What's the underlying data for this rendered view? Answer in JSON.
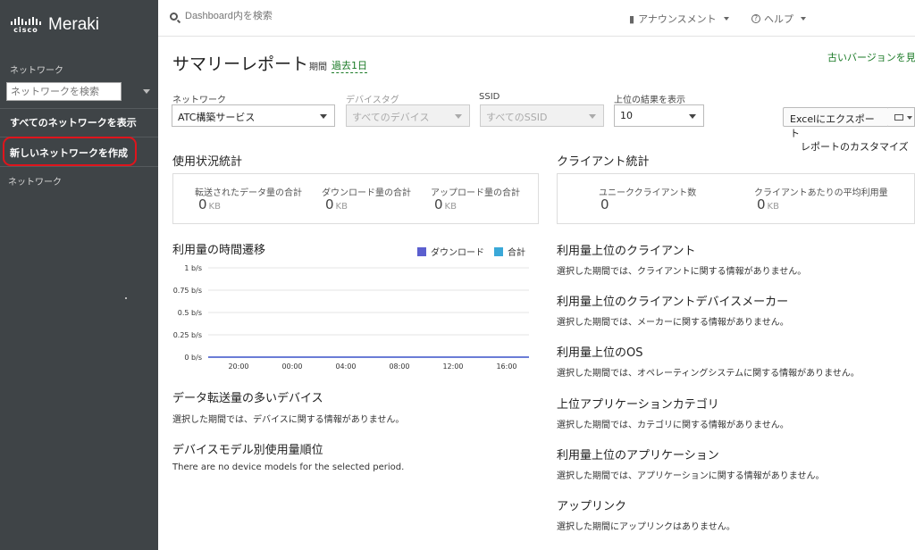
{
  "sidebar": {
    "brand_cisco": "cisco",
    "brand_name": "Meraki",
    "network_label": "ネットワーク",
    "search_placeholder": "ネットワークを検索",
    "show_all": "すべてのネットワークを表示",
    "create_new": "新しいネットワークを作成",
    "network_label_2": "ネットワーク"
  },
  "topbar": {
    "search_placeholder": "Dashboard内を検索",
    "announcements": "アナウンスメント",
    "help": "ヘルプ"
  },
  "header": {
    "title": "サマリーレポート",
    "period_label": "期間",
    "period_value": "過去1日",
    "old_version": "古いバージョンを見る"
  },
  "filters": {
    "network": {
      "label": "ネットワーク",
      "value": "ATC構築サービス"
    },
    "device_tag": {
      "label": "デバイスタグ",
      "value": "すべてのデバイス"
    },
    "ssid": {
      "label": "SSID",
      "value": "すべてのSSID"
    },
    "top_results": {
      "label": "上位の結果を表示",
      "value": "10"
    }
  },
  "toolbar": {
    "export_excel": "Excelにエクスポート",
    "customize": "レポートのカスタマイズ"
  },
  "usage_stats": {
    "title": "使用状況統計",
    "items": [
      {
        "label": "転送されたデータ量の合計",
        "value": "0",
        "unit": "KB"
      },
      {
        "label": "ダウンロード量の合計",
        "value": "0",
        "unit": "KB"
      },
      {
        "label": "アップロード量の合計",
        "value": "0",
        "unit": "KB"
      }
    ]
  },
  "client_stats": {
    "title": "クライアント統計",
    "items": [
      {
        "label": "ユニーククライアント数",
        "value": "0",
        "unit": ""
      },
      {
        "label": "クライアントあたりの平均利用量",
        "value": "0",
        "unit": "KB"
      }
    ]
  },
  "chart_data": {
    "type": "line",
    "title": "利用量の時間遷移",
    "x": [
      "20:00",
      "00:00",
      "04:00",
      "08:00",
      "12:00",
      "16:00"
    ],
    "y_ticks": [
      "1 b/s",
      "0.75 b/s",
      "0.5 b/s",
      "0.25 b/s",
      "0 b/s"
    ],
    "ylim": [
      0,
      1
    ],
    "series": [
      {
        "name": "ダウンロード",
        "color": "#5b5fcf",
        "values": [
          0,
          0,
          0,
          0,
          0,
          0
        ]
      },
      {
        "name": "合計",
        "color": "#3aa8d8",
        "values": [
          0,
          0,
          0,
          0,
          0,
          0
        ]
      }
    ],
    "grid": true,
    "legend": "top-right"
  },
  "left_sections": [
    {
      "title": "データ転送量の多いデバイス",
      "note": "選択した期間では、デバイスに関する情報がありません。"
    },
    {
      "title": "デバイスモデル別使用量順位",
      "note": "There are no device models for the selected period."
    }
  ],
  "right_sections": [
    {
      "title": "利用量上位のクライアント",
      "note": "選択した期間では、クライアントに関する情報がありません。"
    },
    {
      "title": "利用量上位のクライアントデバイスメーカー",
      "note": "選択した期間では、メーカーに関する情報がありません。"
    },
    {
      "title": "利用量上位のOS",
      "note": "選択した期間では、オペレーティングシステムに関する情報がありません。"
    },
    {
      "title": "上位アプリケーションカテゴリ",
      "note": "選択した期間では、カテゴリに関する情報がありません。"
    },
    {
      "title": "利用量上位のアプリケーション",
      "note": "選択した期間では、アプリケーションに関する情報がありません。"
    },
    {
      "title": "アップリンク",
      "note": "選択した期間にアップリンクはありません。"
    }
  ]
}
